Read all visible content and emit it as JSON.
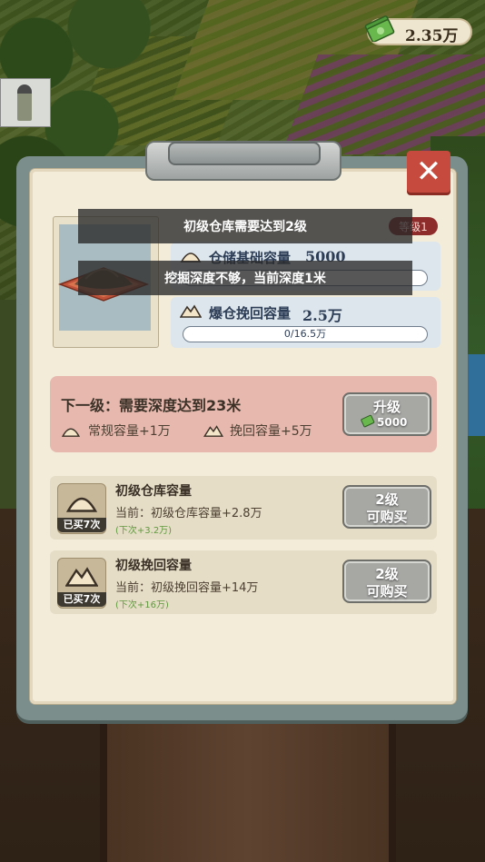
{
  "currency": {
    "amount": "2.35万",
    "icon": "cash-icon"
  },
  "toasts": [
    "初级仓库需要达到2级",
    "挖掘深度不够，当前深度1米"
  ],
  "warehouse": {
    "level_badge": "等级1",
    "storage": {
      "label": "仓储基础容量",
      "value": "5000",
      "icon": "sand-pile-icon"
    },
    "overflow": {
      "label": "爆仓挽回容量",
      "value": "2.5万",
      "progress_text": "0/16.5万",
      "progress": 0,
      "icon": "sand-heap-icon"
    }
  },
  "next_level": {
    "title": "下一级：需要深度达到23米",
    "normal_capacity": "常规容量+1万",
    "recover_capacity": "挽回容量+5万",
    "upgrade_label": "升级",
    "upgrade_cost": "5000"
  },
  "items": [
    {
      "title": "初级仓库容量",
      "current": "当前：初级仓库容量+2.8万",
      "next": "(下次+3.2万)",
      "bought": "已买7次",
      "button_line1": "2级",
      "button_line2": "可购买"
    },
    {
      "title": "初级挽回容量",
      "current": "当前：初级挽回容量+14万",
      "next": "(下次+16万)",
      "bought": "已买7次",
      "button_line1": "2级",
      "button_line2": "可购买"
    }
  ],
  "colors": {
    "accent_red": "#c74a3e",
    "panel_pink": "#e6b8ae",
    "stat_blue": "#dde6ec"
  }
}
